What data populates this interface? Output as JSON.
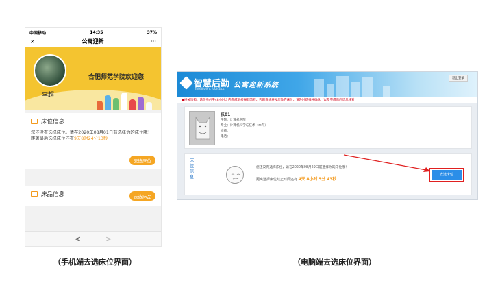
{
  "phone": {
    "status": {
      "carrier": "中国移动",
      "time": "14:35",
      "battery": "37%"
    },
    "nav": {
      "close": "×",
      "title": "公寓迎新",
      "more": "···"
    },
    "banner": {
      "welcome": "合肥师范学院欢迎您",
      "name": "李超"
    },
    "bed_card": {
      "title": "床位信息",
      "line1": "您还没有选择床位。请在2020年08月01日前选择你的床位哦！",
      "line2_prefix": "距离最后选择床位还有",
      "line2_time": "9天8时24分13秒",
      "button": "去选床位"
    },
    "goods_card": {
      "title": "床品信息",
      "button": "去选床品"
    },
    "tabbar": {
      "back": "<",
      "forward": ">"
    }
  },
  "desktop": {
    "brand": "智慧后勤",
    "brand_sub": "Intelligent logistics",
    "system": "公寓迎新系统",
    "logout": "退出登录",
    "notice": "●相关须知：请您务必于48小时之内完成到校报到流程，否则系统将视您放弃床位，请及时选择并确认（以及完成后的信息核对）",
    "profile": {
      "name": "张01",
      "college": "学院：计算机学院",
      "major": "专业：计算机科学与技术（本升）",
      "class": "班级：",
      "phone": "电话："
    },
    "bed": {
      "label": "床位信息",
      "msg1": "您还没有选择床位，请在2020年08月29日前选择你的床位哦！",
      "msg2_prefix": "距离选择床位截止时间还有",
      "days": "4天",
      "hours": "8小时",
      "minutes": "5分",
      "seconds": "43秒",
      "button": "去选床位"
    }
  },
  "captions": {
    "phone": "（手机端去选床位界面）",
    "desktop": "（电脑端去选床位界面）"
  }
}
